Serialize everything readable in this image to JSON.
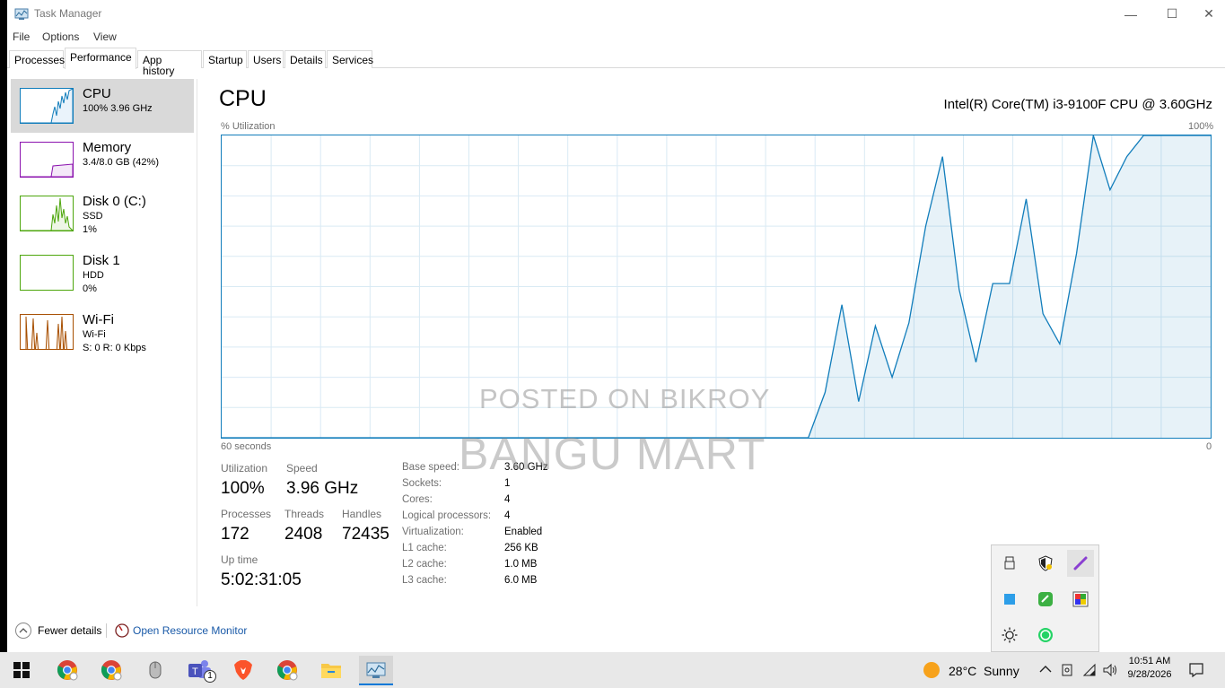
{
  "window": {
    "title": "Task Manager",
    "controls": {
      "minimize": "—",
      "maximize": "☐",
      "close": "✕"
    }
  },
  "menu": [
    "File",
    "Options",
    "View"
  ],
  "tabs": [
    "Processes",
    "Performance",
    "App history",
    "Startup",
    "Users",
    "Details",
    "Services"
  ],
  "active_tab": "Performance",
  "sidebar": {
    "items": [
      {
        "title": "CPU",
        "sub1": "100%  3.96 GHz",
        "sub2": "",
        "color": "#117dbb"
      },
      {
        "title": "Memory",
        "sub1": "3.4/8.0 GB (42%)",
        "sub2": "",
        "color": "#8b12ae"
      },
      {
        "title": "Disk 0 (C:)",
        "sub1": "SSD",
        "sub2": "1%",
        "color": "#4da60c"
      },
      {
        "title": "Disk 1",
        "sub1": "HDD",
        "sub2": "0%",
        "color": "#4da60c"
      },
      {
        "title": "Wi-Fi",
        "sub1": "Wi-Fi",
        "sub2_lbl": "S: 0 R: 0 Kbps",
        "color": "#a74f01"
      }
    ]
  },
  "main": {
    "title": "CPU",
    "cpu_name": "Intel(R) Core(TM) i3-9100F CPU @ 3.60GHz",
    "chart_label": "% Utilization",
    "chart_max": "100%",
    "chart_time": "60 seconds",
    "chart_min": "0"
  },
  "chart_data": {
    "type": "area",
    "title": "",
    "xlabel": "60 seconds",
    "ylabel": "% Utilization",
    "ylim": [
      0,
      100
    ],
    "x": [
      0,
      1,
      2,
      3,
      4,
      5,
      6,
      7,
      8,
      9,
      10,
      11,
      12,
      13,
      14,
      15,
      16,
      17,
      18,
      19,
      20,
      21,
      22,
      23,
      24,
      25,
      26,
      27,
      28,
      29,
      30,
      31,
      32,
      33,
      34,
      35,
      36,
      37,
      38,
      39,
      40,
      41,
      42,
      43,
      44,
      45,
      46,
      47,
      48,
      49,
      50,
      51,
      52,
      53,
      54,
      55,
      56,
      57,
      58,
      59
    ],
    "values": [
      0,
      0,
      0,
      0,
      0,
      0,
      0,
      0,
      0,
      0,
      0,
      0,
      0,
      0,
      0,
      0,
      0,
      0,
      0,
      0,
      0,
      0,
      0,
      0,
      0,
      0,
      0,
      0,
      0,
      0,
      0,
      0,
      0,
      0,
      0,
      0,
      15,
      44,
      12,
      37,
      20,
      38,
      70,
      93,
      49,
      25,
      51,
      51,
      79,
      41,
      31,
      61,
      100,
      82,
      93,
      100,
      100,
      100,
      100,
      100
    ],
    "grid": true
  },
  "stats": {
    "utilization_label": "Utilization",
    "utilization": "100%",
    "speed_label": "Speed",
    "speed": "3.96 GHz",
    "processes_label": "Processes",
    "processes": "172",
    "threads_label": "Threads",
    "threads": "2408",
    "handles_label": "Handles",
    "handles": "72435",
    "uptime_label": "Up time",
    "uptime": "5:02:31:05"
  },
  "specs": [
    {
      "label": "Base speed:",
      "value": "3.60 GHz"
    },
    {
      "label": "Sockets:",
      "value": "1"
    },
    {
      "label": "Cores:",
      "value": "4"
    },
    {
      "label": "Logical processors:",
      "value": "4"
    },
    {
      "label": "Virtualization:",
      "value": "Enabled"
    },
    {
      "label": "L1 cache:",
      "value": "256 KB"
    },
    {
      "label": "L2 cache:",
      "value": "1.0 MB"
    },
    {
      "label": "L3 cache:",
      "value": "6.0 MB"
    }
  ],
  "footer": {
    "fewer_details": "Fewer details",
    "resource_monitor": "Open Resource Monitor"
  },
  "watermark": {
    "line1": "POSTED ON BIKROY",
    "line2": "BANGU MART"
  },
  "tray_popup": [
    "usb-icon",
    "security-icon",
    "pen-icon",
    "blue-square-icon",
    "green-app-icon",
    "color-app-icon",
    "brightness-icon",
    "whatsapp-icon"
  ],
  "taskbar": {
    "weather_temp": "28°C",
    "weather_text": "Sunny",
    "time": "10:51 AM",
    "date": "9/28/2026",
    "teams_badge": "1"
  }
}
